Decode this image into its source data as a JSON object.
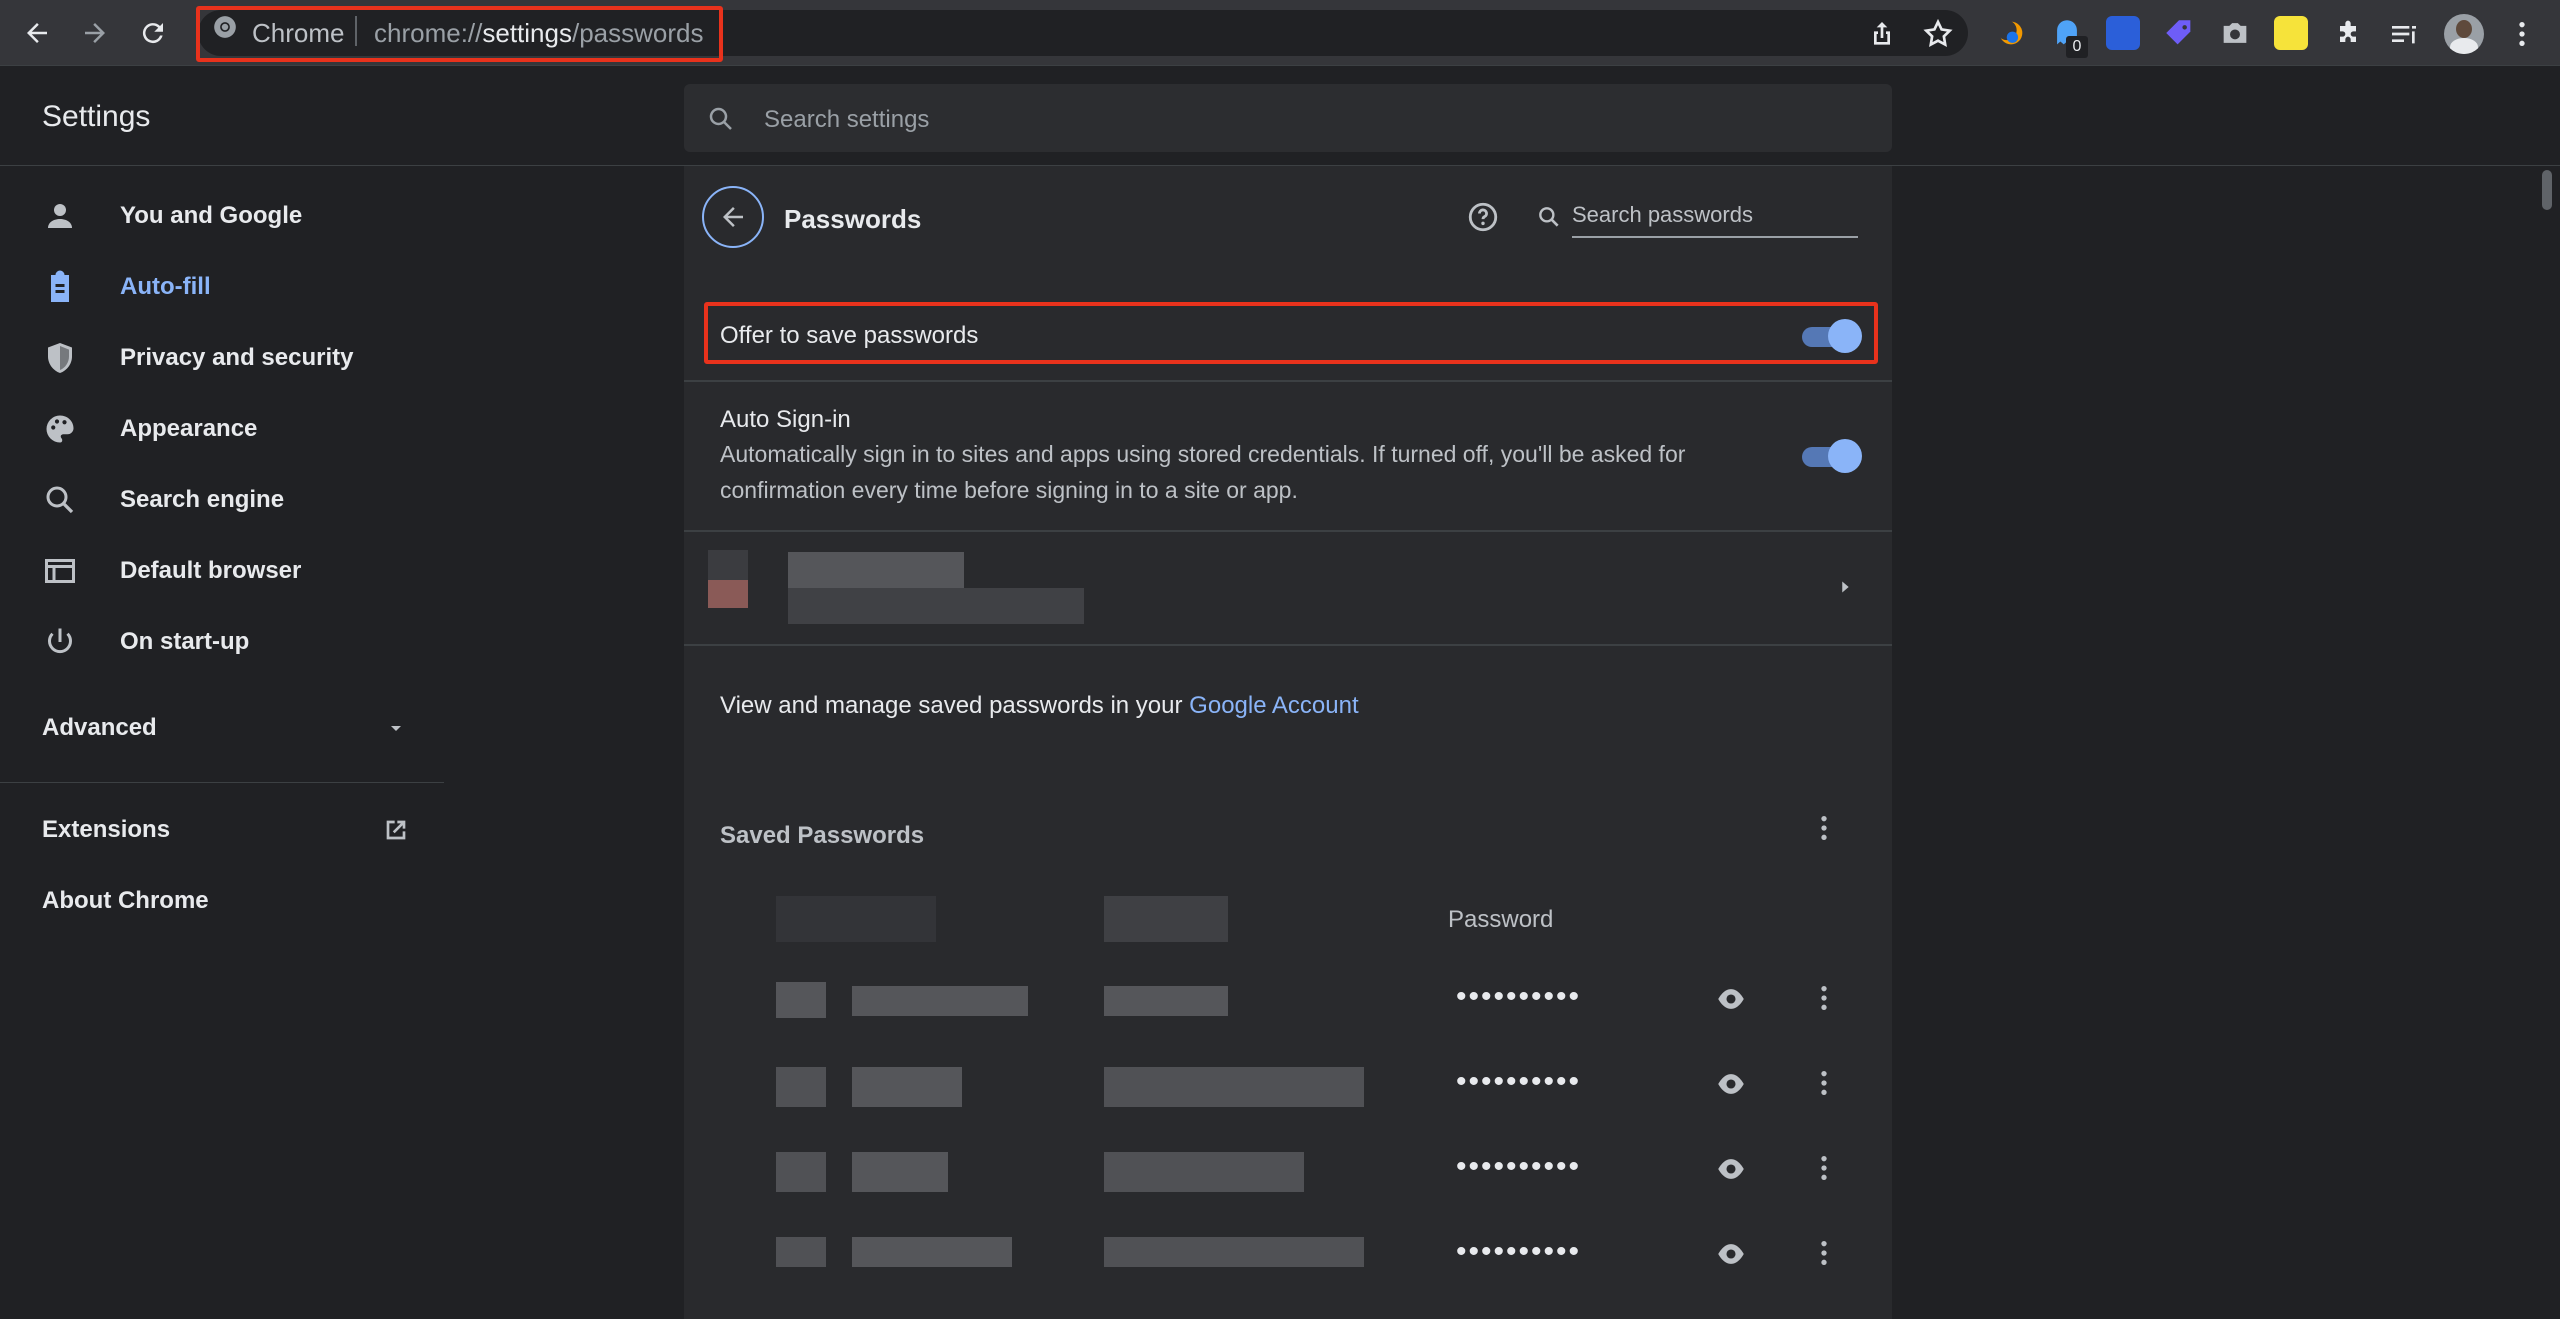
{
  "browser": {
    "omnibox_chip": "Chrome",
    "url_scheme": "chrome://",
    "url_host": "settings",
    "url_path": "/passwords",
    "extension_badge": "0"
  },
  "header": {
    "title": "Settings",
    "search_placeholder": "Search settings"
  },
  "sidebar": {
    "items": [
      {
        "label": "You and Google",
        "icon": "person-icon"
      },
      {
        "label": "Auto-fill",
        "icon": "clipboard-icon"
      },
      {
        "label": "Privacy and security",
        "icon": "shield-icon"
      },
      {
        "label": "Appearance",
        "icon": "palette-icon"
      },
      {
        "label": "Search engine",
        "icon": "search-icon"
      },
      {
        "label": "Default browser",
        "icon": "browser-icon"
      },
      {
        "label": "On start-up",
        "icon": "power-icon"
      }
    ],
    "advanced": "Advanced",
    "extensions": "Extensions",
    "about": "About Chrome"
  },
  "passwords": {
    "title": "Passwords",
    "search_placeholder": "Search passwords",
    "offer_to_save": "Offer to save passwords",
    "auto_signin_title": "Auto Sign-in",
    "auto_signin_desc": "Automatically sign in to sites and apps using stored credentials. If turned off, you'll be asked for confirmation every time before signing in to a site or app.",
    "manage_text": "View and manage saved passwords in your ",
    "manage_link": "Google Account",
    "saved_passwords": "Saved Passwords",
    "password_col": "Password",
    "masked": "••••••••••",
    "accent": "#8ab4f8"
  }
}
